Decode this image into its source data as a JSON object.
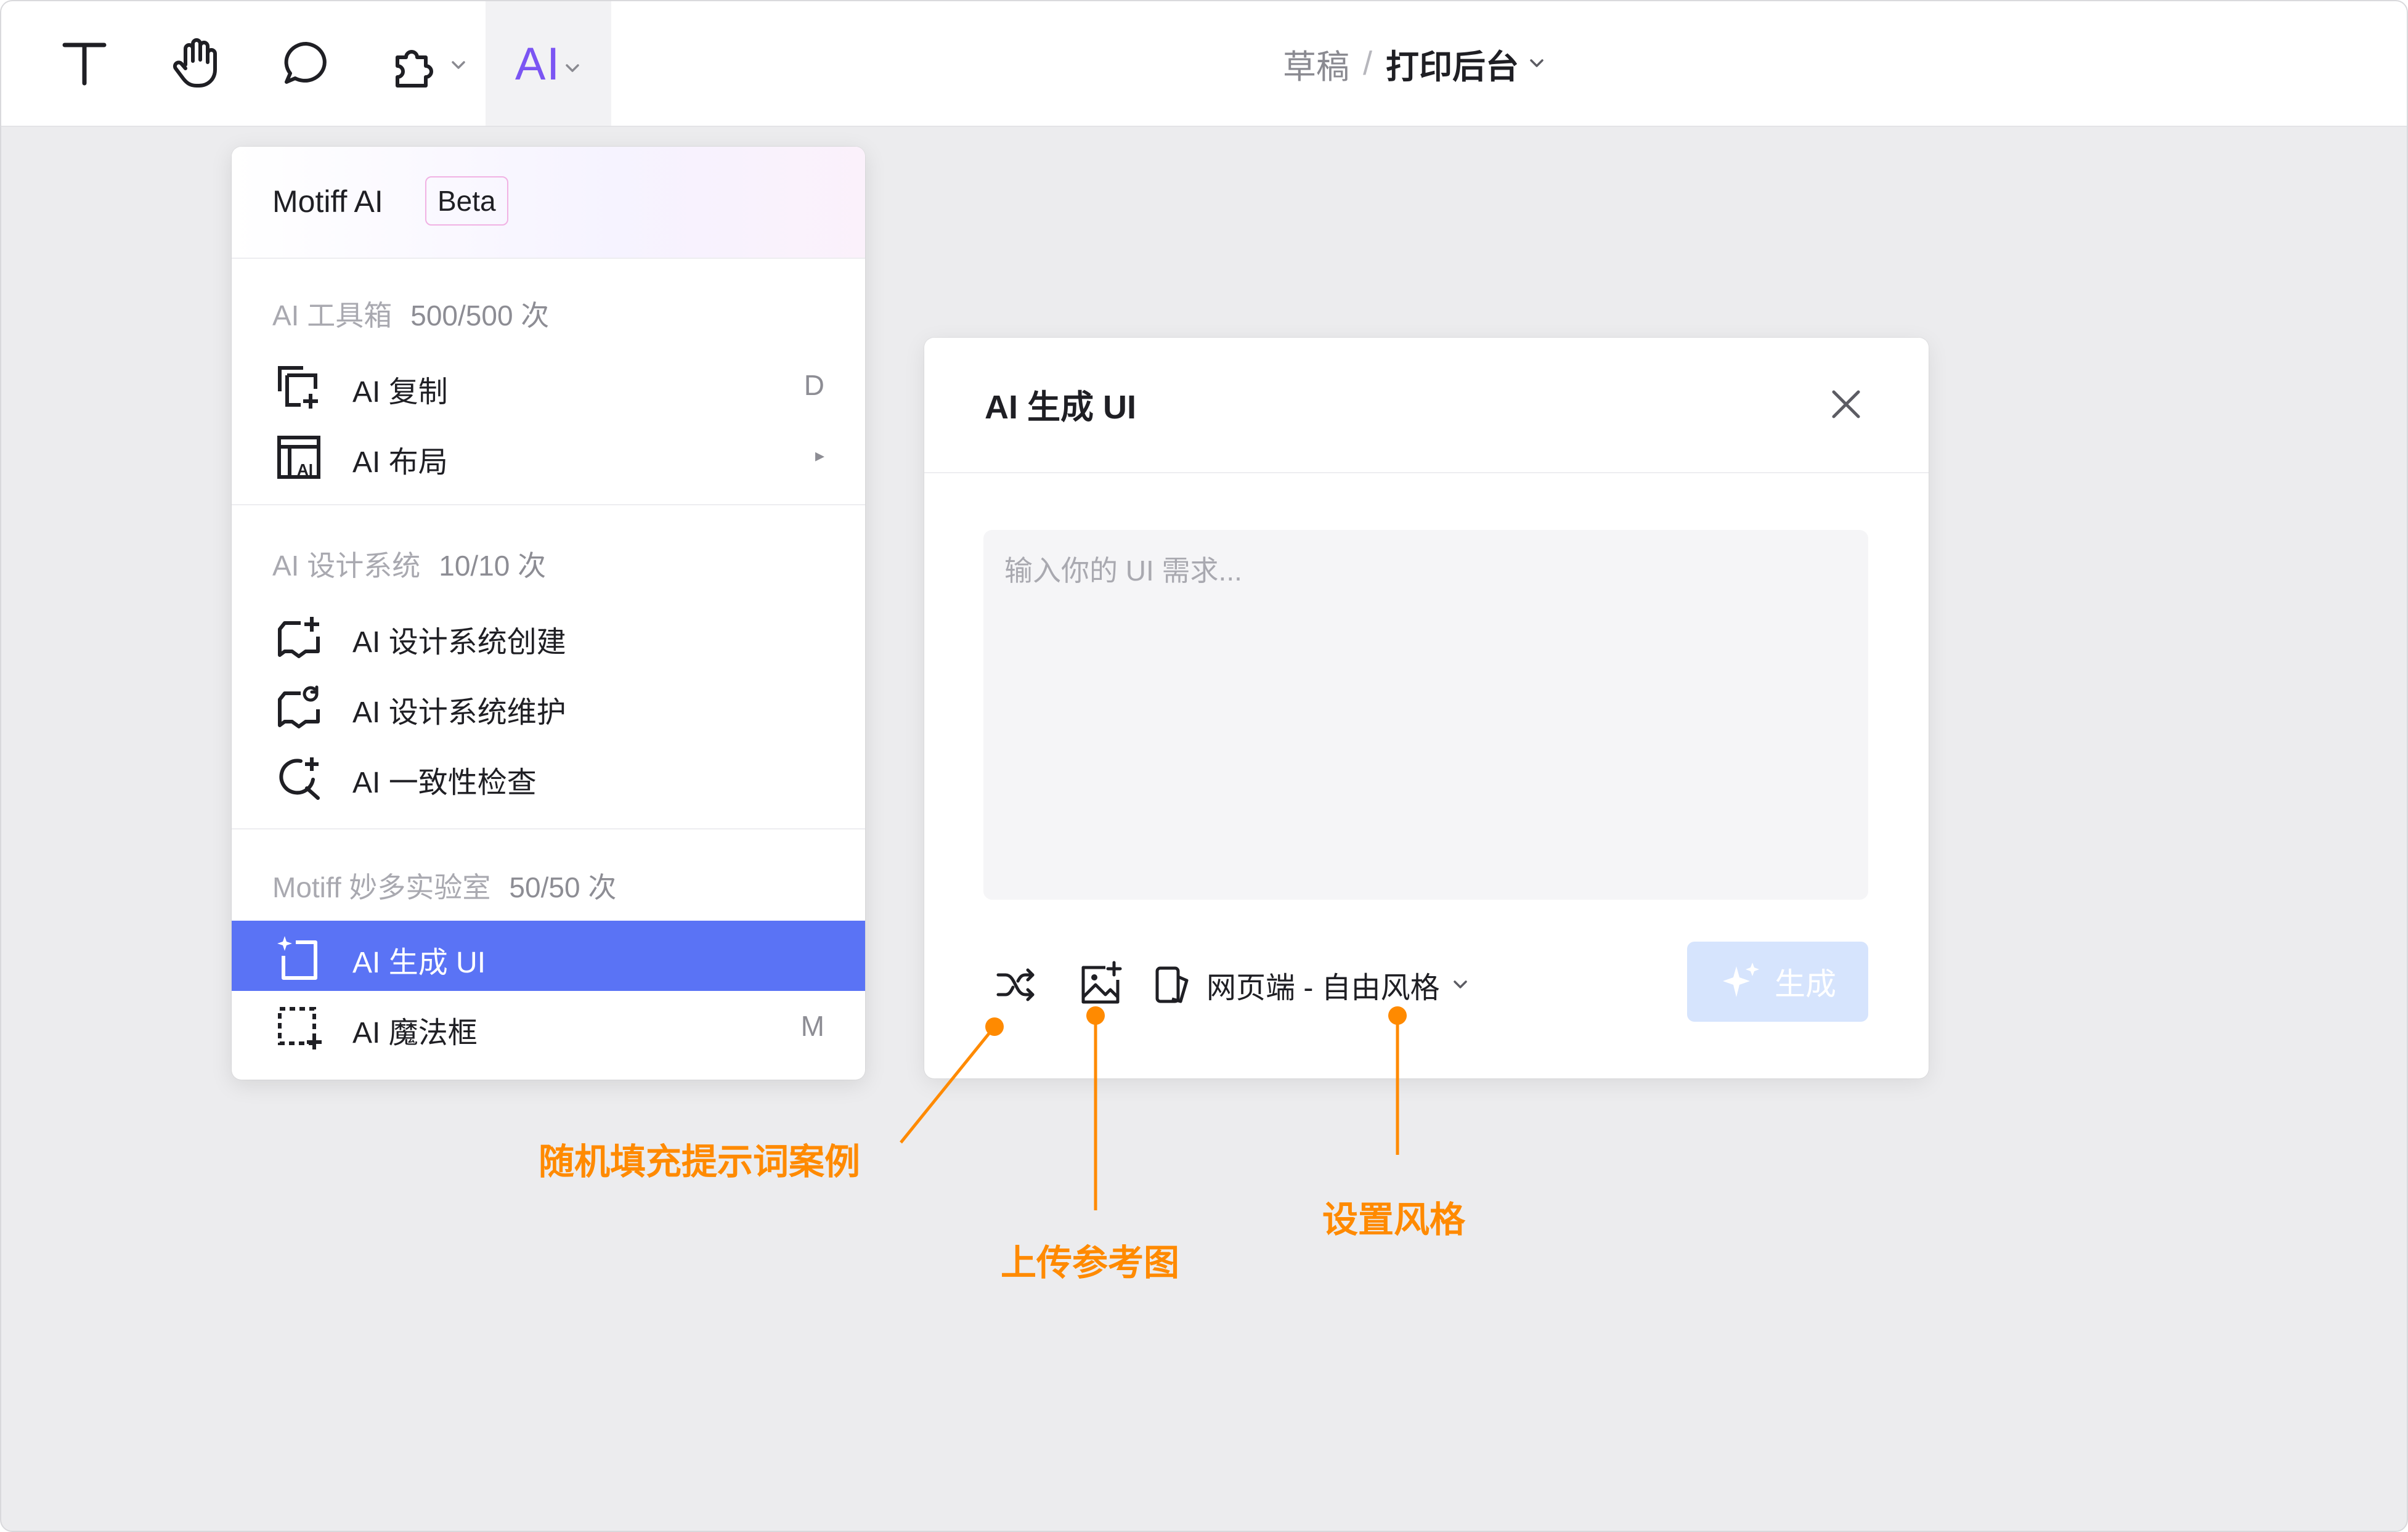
{
  "toolbar": {
    "ai_label": "AI",
    "breadcrumb_parent": "草稿",
    "breadcrumb_separator": "/",
    "breadcrumb_current": "打印后台",
    "tools": [
      "text-tool",
      "hand-tool",
      "comment-tool",
      "plugin-tool",
      "ai-tool"
    ]
  },
  "menu": {
    "title": "Motiff AI",
    "badge": "Beta",
    "sections": [
      {
        "title": "AI 工具箱",
        "quota": "500/500 次",
        "items": [
          {
            "label": "AI 复制",
            "shortcut": "D",
            "icon": "ai-copy-icon"
          },
          {
            "label": "AI 布局",
            "shortcut": "▸",
            "icon": "ai-layout-icon"
          }
        ]
      },
      {
        "title": "AI 设计系统",
        "quota": "10/10 次",
        "items": [
          {
            "label": "AI 设计系统创建",
            "shortcut": "",
            "icon": "design-system-create-icon"
          },
          {
            "label": "AI 设计系统维护",
            "shortcut": "",
            "icon": "design-system-maintain-icon"
          },
          {
            "label": "AI 一致性检查",
            "shortcut": "",
            "icon": "consistency-check-icon"
          }
        ]
      },
      {
        "title": "Motiff 妙多实验室",
        "quota": "50/50 次",
        "items": [
          {
            "label": "AI 生成 UI",
            "shortcut": "",
            "icon": "generate-ui-icon",
            "active": true
          },
          {
            "label": "AI 魔法框",
            "shortcut": "M",
            "icon": "magic-box-icon"
          }
        ]
      }
    ]
  },
  "dialog": {
    "title": "AI 生成 UI",
    "input_placeholder": "输入你的 UI 需求...",
    "style_label": "网页端 - 自由风格",
    "generate_label": "生成"
  },
  "annotations": {
    "random_fill": "随机填充提示词案例",
    "upload_reference": "上传参考图",
    "set_style": "设置风格"
  },
  "colors": {
    "accent": "#5a73f5",
    "annotation": "#ff8a00",
    "generate_disabled": "#d6e4fd",
    "ai_gradient_start": "#6b5cf6",
    "ai_gradient_end": "#a44ef0"
  }
}
